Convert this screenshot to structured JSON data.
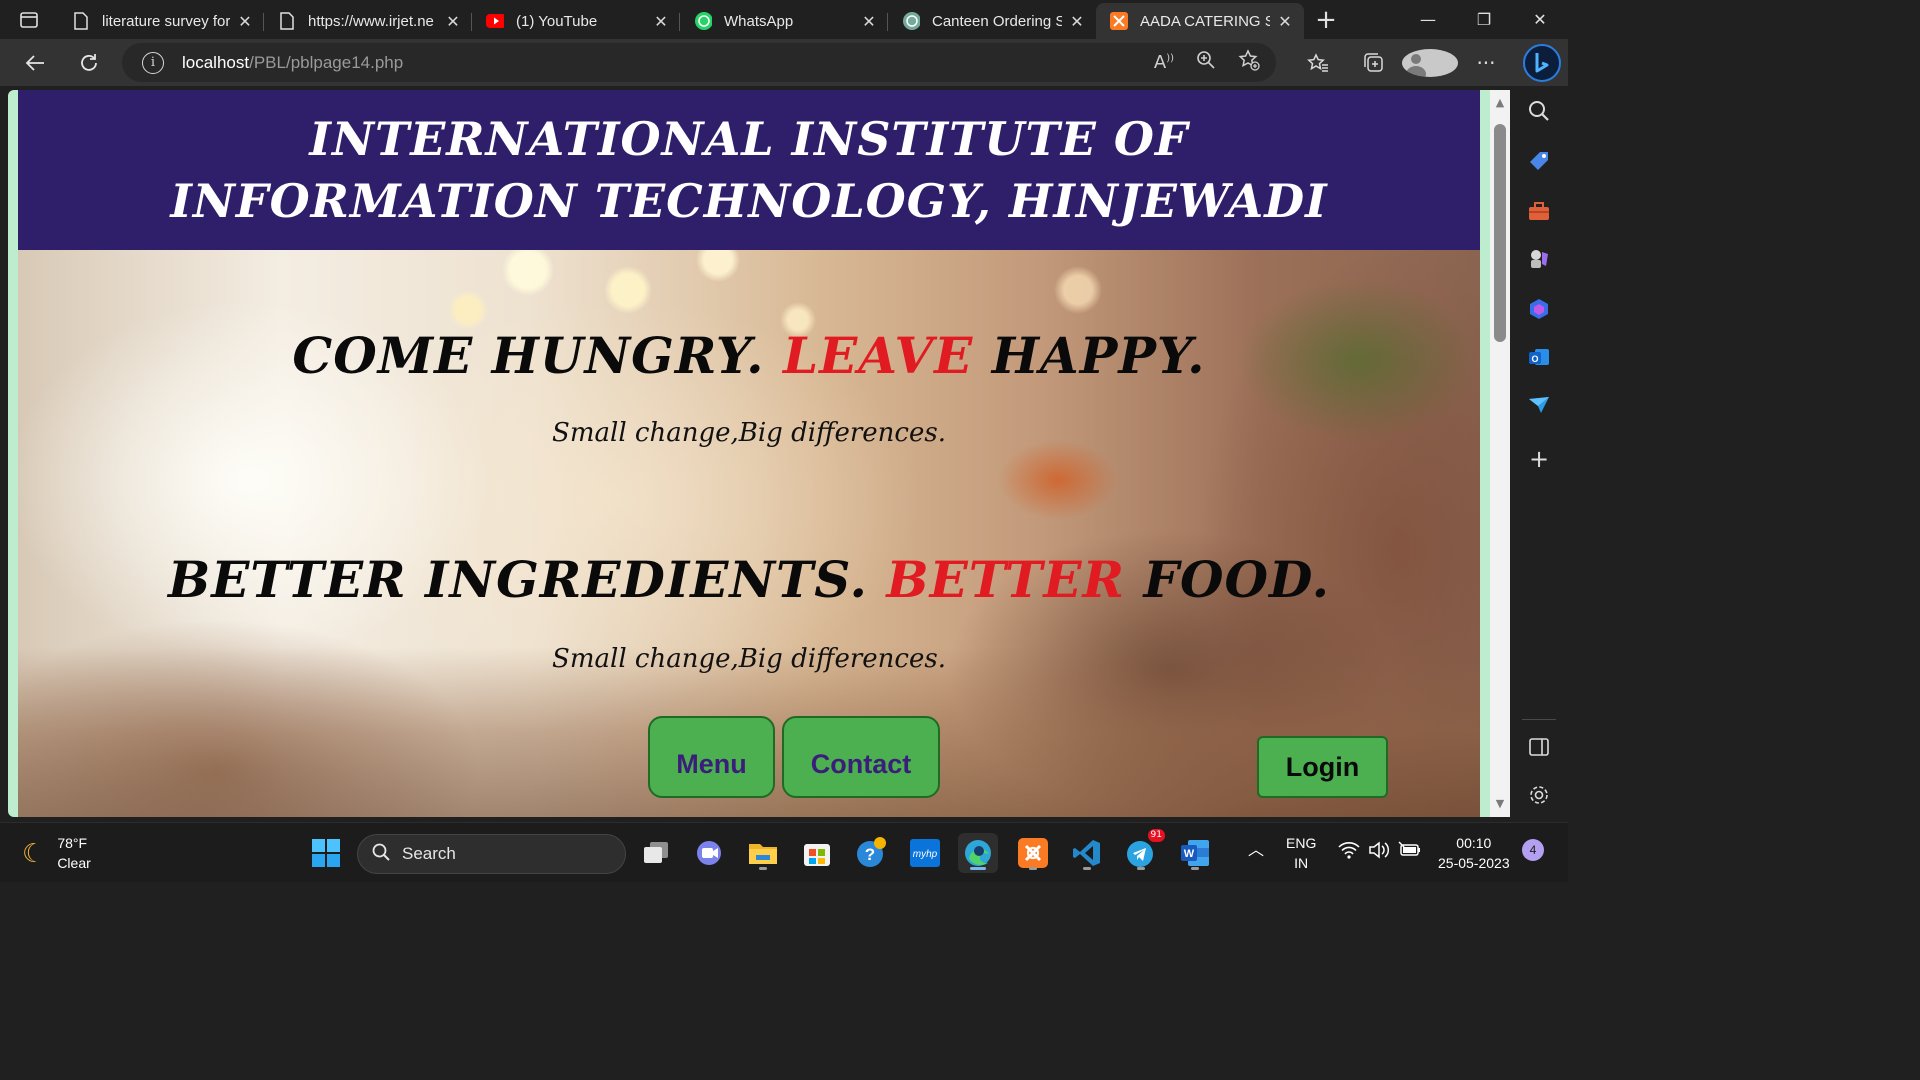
{
  "browser": {
    "tabs": [
      {
        "title": "literature survey for",
        "favicon": "document-icon",
        "active": false
      },
      {
        "title": "https://www.irjet.ne",
        "favicon": "document-icon",
        "active": false
      },
      {
        "title": "(1) YouTube",
        "favicon": "youtube-icon",
        "active": false
      },
      {
        "title": "WhatsApp",
        "favicon": "whatsapp-icon",
        "active": false
      },
      {
        "title": "Canteen Ordering S",
        "favicon": "chatgpt-icon",
        "active": false
      },
      {
        "title": "AADA CATERING SE",
        "favicon": "xampp-icon",
        "active": true
      }
    ],
    "address": {
      "host": "localhost",
      "path": "/PBL/pblpage14.php"
    },
    "accent": "#2f1f6b"
  },
  "page": {
    "header_title": "INTERNATIONAL INSTITUTE OF INFORMATION TECHNOLOGY, HINJEWADI",
    "tagline1": {
      "part1": "COME HUNGRY. ",
      "highlight": "LEAVE",
      "part2": " HAPPY."
    },
    "subtitle1": "Small change,Big differences.",
    "tagline2": {
      "part1": "BETTER INGREDIENTS. ",
      "highlight": "BETTER",
      "part2": " FOOD."
    },
    "subtitle2": "Small change,Big differences.",
    "buttons": {
      "menu": "Menu",
      "contact": "Contact",
      "login": "Login"
    },
    "colors": {
      "highlight": "#e01b22",
      "button_bg": "#4caf50",
      "header_bg": "#2f1f6b"
    }
  },
  "taskbar": {
    "weather_temp": "78°F",
    "weather_desc": "Clear",
    "search_placeholder": "Search",
    "lang_line1": "ENG",
    "lang_line2": "IN",
    "time": "00:10",
    "date": "25-05-2023",
    "notification_count": "4",
    "telegram_badge": "91"
  }
}
